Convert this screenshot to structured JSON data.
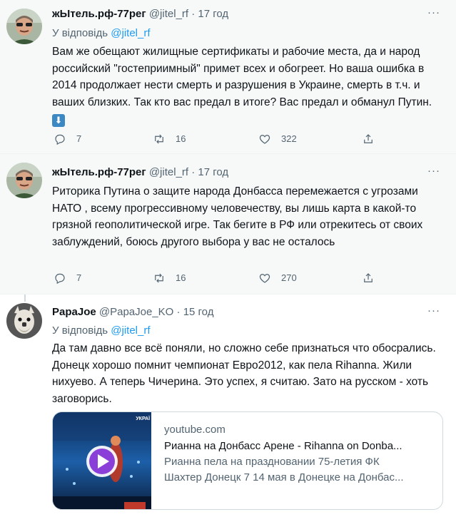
{
  "tweets": [
    {
      "name": "жЫтель.рф-77рег",
      "handle": "@jitel_rf",
      "dot": "·",
      "time": "17 год",
      "reply_label": "У відповідь",
      "reply_handle": "@jitel_rf",
      "text": "Вам же обещают жилищные сертификаты и рабочие места, да и народ российский \"гостеприимный\" примет всех и обогреет. Но ваша ошибка в 2014 продолжает нести смерть и разрушения в Украине, смерть в т.ч. и ваших близких. Так кто вас предал в итоге? Вас предал и обманул Путин.",
      "emoji": "⬇",
      "replies": "7",
      "retweets": "16",
      "likes": "322"
    },
    {
      "name": "жЫтель.рф-77рег",
      "handle": "@jitel_rf",
      "dot": "·",
      "time": "17 год",
      "text": "Риторика Путина о защите народа Донбасса перемежается с угрозами НАТО , всему прогрессивному человечеству, вы лишь карта в какой-то грязной геополитической игре. Так бегите в РФ или отрекитесь от своих заблуждений, боюсь другого выбора у вас не осталось",
      "replies": "7",
      "retweets": "16",
      "likes": "270"
    },
    {
      "name": "PapaJoe",
      "handle": "@PapaJoe_KO",
      "dot": "·",
      "time": "15 год",
      "reply_label": "У відповідь",
      "reply_handle": "@jitel_rf",
      "text": "Да там давно все всё поняли, но сложно себе признаться что обосрались. Донецк хорошо помнит чемпионат  Евро2012, как пела Rihanna. Жили нихуево. А теперь Чичерина. Это успех, я считаю. Зато на русском - хоть заговорись.",
      "card": {
        "domain": "youtube.com",
        "title": "Рианна на Донбасс Арене - Rihanna on Donba...",
        "desc_line1": "Рианна пела на праздновании 75-летия ФК",
        "desc_line2": "Шахтер Донецк 7 14 мая в Донецке на Донбас...",
        "thumb_caption": "УКРАЇ"
      }
    }
  ],
  "more_label": "···",
  "colors": {
    "accent": "#1d9bf0",
    "muted": "#536471",
    "highlight_bg": "#f7f9f9",
    "play": "#8b3fd9"
  }
}
